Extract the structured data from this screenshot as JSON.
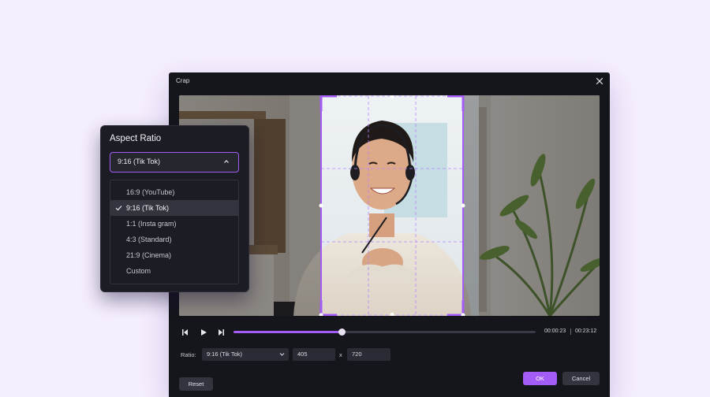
{
  "dialog": {
    "title": "Crap"
  },
  "playback": {
    "current_time": "00:00:23",
    "total_time": "00:23:12",
    "progress": 0.36
  },
  "ratio_row": {
    "label": "Ratio:",
    "selected": "9:16 (Tik Tok)",
    "width": "405",
    "height": "720",
    "separator": "x"
  },
  "buttons": {
    "ok": "OK",
    "cancel": "Cancel",
    "reset": "Reset"
  },
  "aspect_panel": {
    "title": "Aspect Ratio",
    "selected": "9:16 (Tik Tok)",
    "options": [
      {
        "label": "16:9 (YouTube)",
        "selected": false
      },
      {
        "label": "9:16 (Tik Tok)",
        "selected": true
      },
      {
        "label": "1:1 (Insta gram)",
        "selected": false
      },
      {
        "label": "4:3 (Standard)",
        "selected": false
      },
      {
        "label": "21:9 (Cinema)",
        "selected": false
      },
      {
        "label": "Custom",
        "selected": false
      }
    ]
  },
  "icons": {
    "close": "close-icon",
    "step_back": "step-back-icon",
    "play": "play-icon",
    "step_forward": "step-forward-icon",
    "dropdown": "chevron-down-icon",
    "collapse": "chevron-up-icon",
    "check": "check-icon"
  },
  "colors": {
    "accent": "#a35cf5",
    "dialog_bg": "#15151c",
    "page_bg": "#f5eefe"
  }
}
